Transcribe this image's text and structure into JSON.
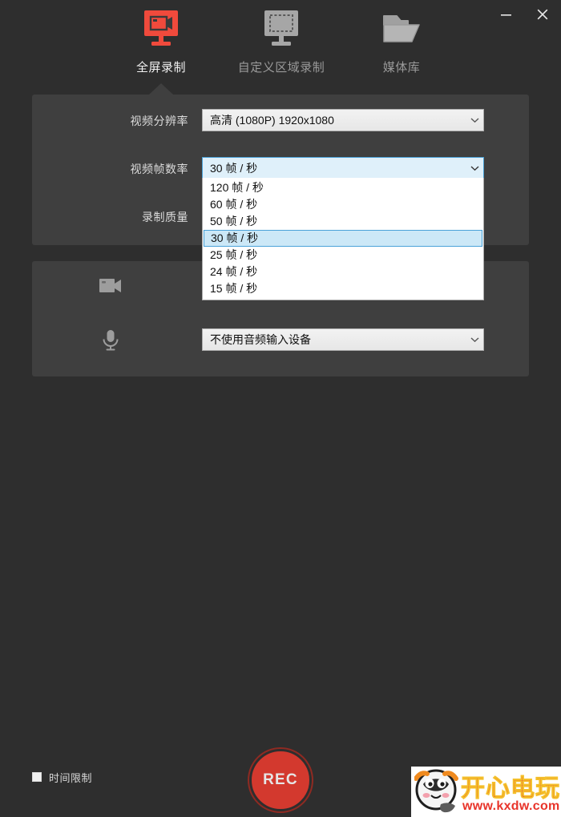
{
  "window": {
    "minimize_label": "minimize",
    "close_label": "close"
  },
  "tabs": [
    {
      "label": "全屏录制",
      "icon": "monitor-record-icon",
      "active": true
    },
    {
      "label": "自定义区域录制",
      "icon": "monitor-region-icon",
      "active": false
    },
    {
      "label": "媒体库",
      "icon": "folder-icon",
      "active": false
    }
  ],
  "settings": {
    "resolution": {
      "label": "视频分辨率",
      "value": "高清 (1080P)   1920x1080"
    },
    "framerate": {
      "label": "视频帧数率",
      "value": "30 帧 / 秒",
      "options": [
        "120 帧 / 秒",
        "60 帧 / 秒",
        "50 帧 / 秒",
        "30 帧 / 秒",
        "25 帧 / 秒",
        "24 帧 / 秒",
        "15 帧 / 秒"
      ],
      "selected_index": 3
    },
    "quality": {
      "label": "录制质量"
    }
  },
  "devices": {
    "camera": {
      "icon": "video-camera-icon"
    },
    "microphone": {
      "icon": "microphone-icon",
      "value": "不使用音频输入设备"
    }
  },
  "footer": {
    "time_limit_label": "时间限制",
    "time_limit_checked": true,
    "record_button_label": "REC"
  },
  "watermark": {
    "name_cn": "开心电玩",
    "url": "www.kxdw.com"
  },
  "colors": {
    "accent_red": "#f04a3c",
    "rec_red": "#d3392e",
    "bg_dark": "#2e2e2e",
    "panel": "#3f3f3f",
    "highlight_blue": "#cce8f7"
  }
}
